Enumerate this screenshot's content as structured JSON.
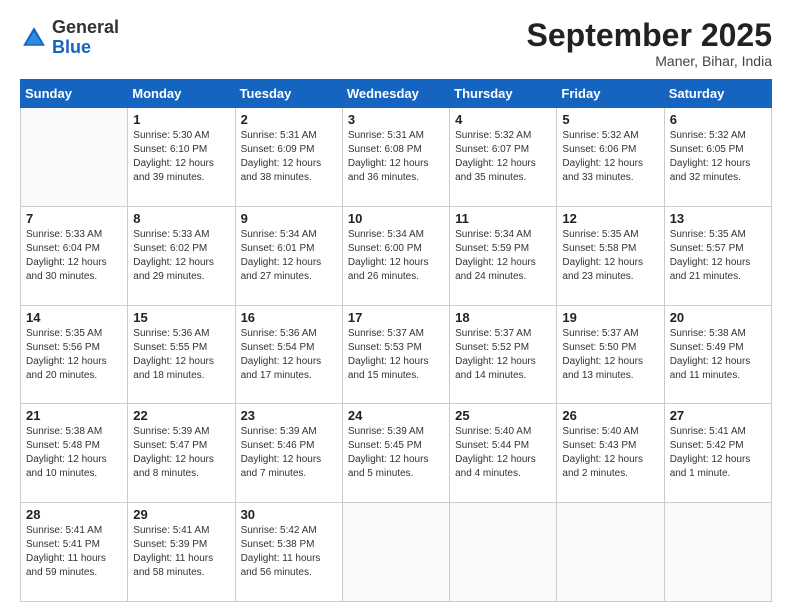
{
  "header": {
    "logo_general": "General",
    "logo_blue": "Blue",
    "month_title": "September 2025",
    "location": "Maner, Bihar, India"
  },
  "weekdays": [
    "Sunday",
    "Monday",
    "Tuesday",
    "Wednesday",
    "Thursday",
    "Friday",
    "Saturday"
  ],
  "weeks": [
    [
      {
        "day": "",
        "info": ""
      },
      {
        "day": "1",
        "info": "Sunrise: 5:30 AM\nSunset: 6:10 PM\nDaylight: 12 hours\nand 39 minutes."
      },
      {
        "day": "2",
        "info": "Sunrise: 5:31 AM\nSunset: 6:09 PM\nDaylight: 12 hours\nand 38 minutes."
      },
      {
        "day": "3",
        "info": "Sunrise: 5:31 AM\nSunset: 6:08 PM\nDaylight: 12 hours\nand 36 minutes."
      },
      {
        "day": "4",
        "info": "Sunrise: 5:32 AM\nSunset: 6:07 PM\nDaylight: 12 hours\nand 35 minutes."
      },
      {
        "day": "5",
        "info": "Sunrise: 5:32 AM\nSunset: 6:06 PM\nDaylight: 12 hours\nand 33 minutes."
      },
      {
        "day": "6",
        "info": "Sunrise: 5:32 AM\nSunset: 6:05 PM\nDaylight: 12 hours\nand 32 minutes."
      }
    ],
    [
      {
        "day": "7",
        "info": "Sunrise: 5:33 AM\nSunset: 6:04 PM\nDaylight: 12 hours\nand 30 minutes."
      },
      {
        "day": "8",
        "info": "Sunrise: 5:33 AM\nSunset: 6:02 PM\nDaylight: 12 hours\nand 29 minutes."
      },
      {
        "day": "9",
        "info": "Sunrise: 5:34 AM\nSunset: 6:01 PM\nDaylight: 12 hours\nand 27 minutes."
      },
      {
        "day": "10",
        "info": "Sunrise: 5:34 AM\nSunset: 6:00 PM\nDaylight: 12 hours\nand 26 minutes."
      },
      {
        "day": "11",
        "info": "Sunrise: 5:34 AM\nSunset: 5:59 PM\nDaylight: 12 hours\nand 24 minutes."
      },
      {
        "day": "12",
        "info": "Sunrise: 5:35 AM\nSunset: 5:58 PM\nDaylight: 12 hours\nand 23 minutes."
      },
      {
        "day": "13",
        "info": "Sunrise: 5:35 AM\nSunset: 5:57 PM\nDaylight: 12 hours\nand 21 minutes."
      }
    ],
    [
      {
        "day": "14",
        "info": "Sunrise: 5:35 AM\nSunset: 5:56 PM\nDaylight: 12 hours\nand 20 minutes."
      },
      {
        "day": "15",
        "info": "Sunrise: 5:36 AM\nSunset: 5:55 PM\nDaylight: 12 hours\nand 18 minutes."
      },
      {
        "day": "16",
        "info": "Sunrise: 5:36 AM\nSunset: 5:54 PM\nDaylight: 12 hours\nand 17 minutes."
      },
      {
        "day": "17",
        "info": "Sunrise: 5:37 AM\nSunset: 5:53 PM\nDaylight: 12 hours\nand 15 minutes."
      },
      {
        "day": "18",
        "info": "Sunrise: 5:37 AM\nSunset: 5:52 PM\nDaylight: 12 hours\nand 14 minutes."
      },
      {
        "day": "19",
        "info": "Sunrise: 5:37 AM\nSunset: 5:50 PM\nDaylight: 12 hours\nand 13 minutes."
      },
      {
        "day": "20",
        "info": "Sunrise: 5:38 AM\nSunset: 5:49 PM\nDaylight: 12 hours\nand 11 minutes."
      }
    ],
    [
      {
        "day": "21",
        "info": "Sunrise: 5:38 AM\nSunset: 5:48 PM\nDaylight: 12 hours\nand 10 minutes."
      },
      {
        "day": "22",
        "info": "Sunrise: 5:39 AM\nSunset: 5:47 PM\nDaylight: 12 hours\nand 8 minutes."
      },
      {
        "day": "23",
        "info": "Sunrise: 5:39 AM\nSunset: 5:46 PM\nDaylight: 12 hours\nand 7 minutes."
      },
      {
        "day": "24",
        "info": "Sunrise: 5:39 AM\nSunset: 5:45 PM\nDaylight: 12 hours\nand 5 minutes."
      },
      {
        "day": "25",
        "info": "Sunrise: 5:40 AM\nSunset: 5:44 PM\nDaylight: 12 hours\nand 4 minutes."
      },
      {
        "day": "26",
        "info": "Sunrise: 5:40 AM\nSunset: 5:43 PM\nDaylight: 12 hours\nand 2 minutes."
      },
      {
        "day": "27",
        "info": "Sunrise: 5:41 AM\nSunset: 5:42 PM\nDaylight: 12 hours\nand 1 minute."
      }
    ],
    [
      {
        "day": "28",
        "info": "Sunrise: 5:41 AM\nSunset: 5:41 PM\nDaylight: 11 hours\nand 59 minutes."
      },
      {
        "day": "29",
        "info": "Sunrise: 5:41 AM\nSunset: 5:39 PM\nDaylight: 11 hours\nand 58 minutes."
      },
      {
        "day": "30",
        "info": "Sunrise: 5:42 AM\nSunset: 5:38 PM\nDaylight: 11 hours\nand 56 minutes."
      },
      {
        "day": "",
        "info": ""
      },
      {
        "day": "",
        "info": ""
      },
      {
        "day": "",
        "info": ""
      },
      {
        "day": "",
        "info": ""
      }
    ]
  ]
}
